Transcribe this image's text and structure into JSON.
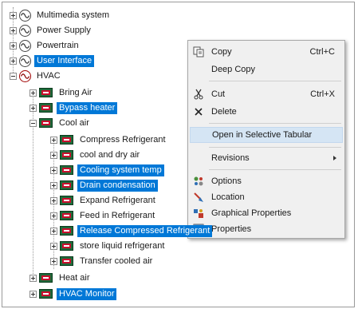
{
  "tree": {
    "items": [
      {
        "label": "Multimedia system",
        "selected": false
      },
      {
        "label": "Power Supply",
        "selected": false
      },
      {
        "label": "Powertrain",
        "selected": false
      },
      {
        "label": "User Interface",
        "selected": true
      },
      {
        "label": "HVAC",
        "selected": false
      },
      {
        "label": "Bring Air",
        "selected": false
      },
      {
        "label": "Bypass heater",
        "selected": true
      },
      {
        "label": "Cool air",
        "selected": false
      },
      {
        "label": "Compress Refrigerant",
        "selected": false
      },
      {
        "label": "cool and dry air",
        "selected": false
      },
      {
        "label": "Cooling system temp",
        "selected": true
      },
      {
        "label": "Drain condensation",
        "selected": true
      },
      {
        "label": "Expand Refrigerant",
        "selected": false
      },
      {
        "label": "Feed in Refrigerant",
        "selected": false
      },
      {
        "label": "Release Compressed Refrigerant",
        "selected": true
      },
      {
        "label": "store liquid refrigerant",
        "selected": false
      },
      {
        "label": "Transfer cooled air",
        "selected": false
      },
      {
        "label": "Heat air",
        "selected": false
      },
      {
        "label": "HVAC Monitor",
        "selected": true
      }
    ]
  },
  "context_menu": {
    "copy": "Copy",
    "copy_shortcut": "Ctrl+C",
    "deep_copy": "Deep Copy",
    "cut": "Cut",
    "cut_shortcut": "Ctrl+X",
    "delete": "Delete",
    "open_selective_tabular": "Open in Selective Tabular",
    "revisions": "Revisions",
    "options": "Options",
    "location": "Location",
    "graphical_properties": "Graphical Properties",
    "properties": "Properties"
  },
  "icons": {
    "function": "function-block-icon",
    "system": "sine-circle-icon"
  },
  "colors": {
    "selection": "#0078d7",
    "menu_highlight": "#d5e5f4"
  }
}
